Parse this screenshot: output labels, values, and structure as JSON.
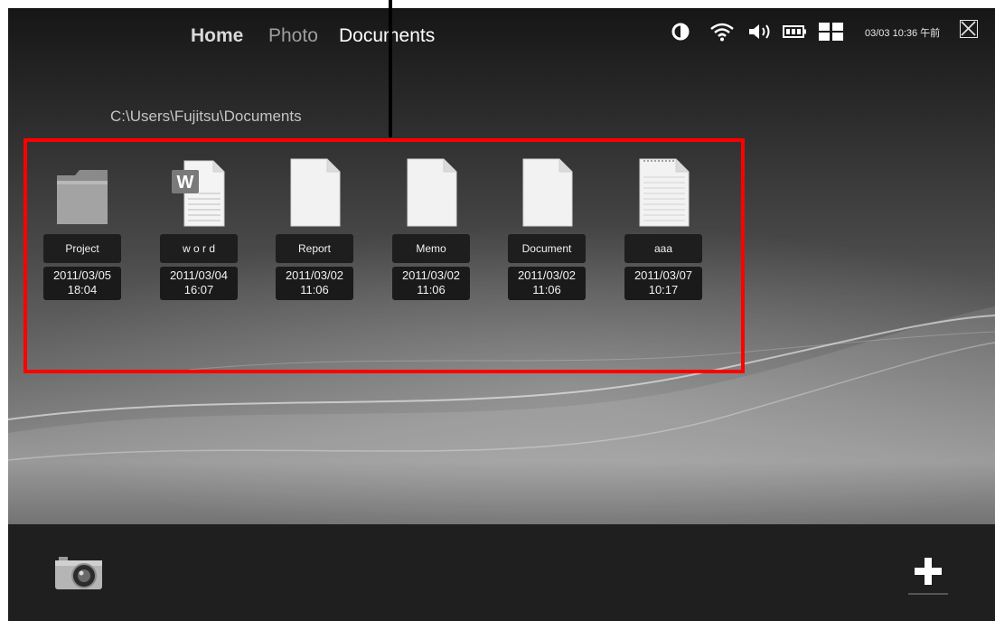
{
  "nav": {
    "home": "Home",
    "photo": "Photo",
    "documents": "Documents"
  },
  "status": {
    "clock": "03/03 10:36 午前",
    "icons": [
      "brightness-icon",
      "wifi-icon",
      "volume-icon",
      "battery-icon",
      "grid-icon",
      "close-icon"
    ]
  },
  "path": "C:\\Users\\Fujitsu\\Documents",
  "files": [
    {
      "name": "Project",
      "date": "2011/03/05",
      "time": "18:04",
      "icon": "folder-icon"
    },
    {
      "name": "w o r d",
      "date": "2011/03/04",
      "time": "16:07",
      "icon": "word-document-icon"
    },
    {
      "name": "Report",
      "date": "2011/03/02",
      "time": "11:06",
      "icon": "blank-file-icon"
    },
    {
      "name": "Memo",
      "date": "2011/03/02",
      "time": "11:06",
      "icon": "blank-file-icon"
    },
    {
      "name": "Document",
      "date": "2011/03/02",
      "time": "11:06",
      "icon": "blank-file-icon"
    },
    {
      "name": "aaa",
      "date": "2011/03/07",
      "time": "10:17",
      "icon": "text-file-icon"
    }
  ],
  "bottom": {
    "camera_icon": "camera-icon",
    "add_icon": "plus-icon"
  },
  "colors": {
    "highlight": "#ff0000",
    "label_bg": "#1e1e1e",
    "bottombar": "#1f1f1f"
  }
}
